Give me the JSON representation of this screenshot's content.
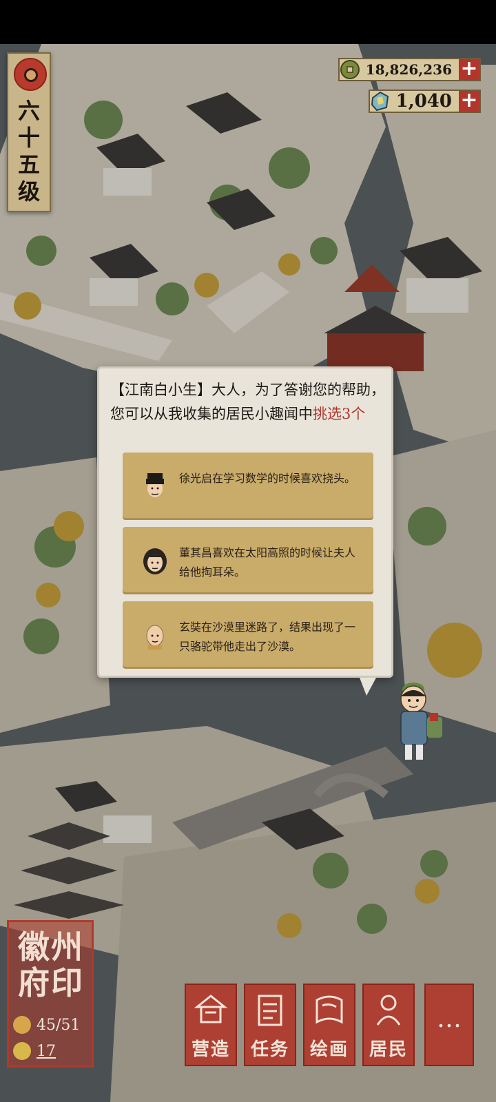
{
  "level": {
    "text": "六十五级"
  },
  "currencies": [
    {
      "icon": "copper-coin-icon",
      "value": "18,826,236",
      "plus": "+"
    },
    {
      "icon": "jade-gem-icon",
      "value": "1,040",
      "plus": "+"
    }
  ],
  "dialog": {
    "speaker": "【江南白小生】",
    "message": "大人，为了答谢您的帮助，您可以从我收集的居民小趣闻中",
    "highlight": "挑选3个",
    "options": [
      {
        "text": "徐光启在学习数学的时候喜欢挠头。",
        "avatar": "scholar-avatar-icon"
      },
      {
        "text": "董其昌喜欢在太阳高照的时候让夫人给他掏耳朵。",
        "avatar": "long-hair-avatar-icon"
      },
      {
        "text": "玄奘在沙漠里迷路了，结果出现了一只骆驼带他走出了沙漠。",
        "avatar": "monk-avatar-icon"
      }
    ]
  },
  "seal": {
    "chars": "徽州府印",
    "residents": "45/51",
    "count": "17"
  },
  "nav": [
    {
      "label": "营造",
      "icon": "build-icon"
    },
    {
      "label": "任务",
      "icon": "task-book-icon"
    },
    {
      "label": "绘画",
      "icon": "scroll-icon"
    },
    {
      "label": "居民",
      "icon": "resident-icon"
    }
  ],
  "more_label": "…",
  "colors": {
    "accent_red": "#b0362c",
    "parchment": "#e9e4da",
    "option_gold": "#c9ab6a"
  }
}
